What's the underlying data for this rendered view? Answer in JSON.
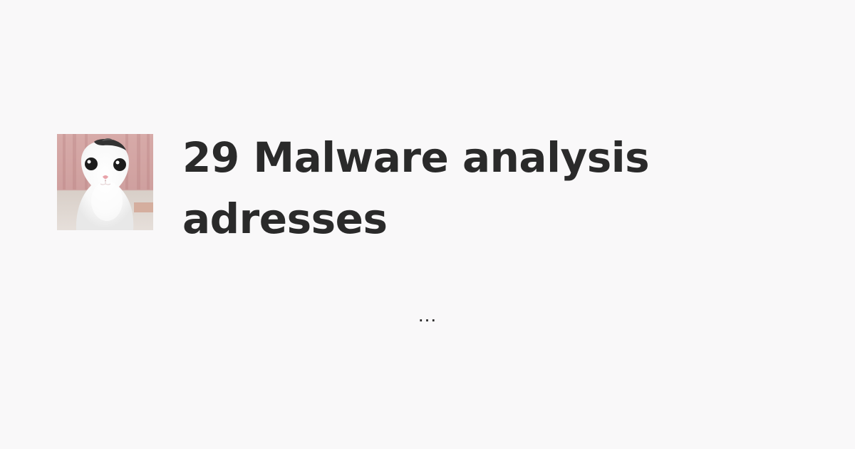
{
  "post": {
    "title": "29 Malware analysis adresses",
    "ellipsis": "...",
    "avatar": {
      "icon": "white-cat-photo-icon"
    }
  },
  "colors": {
    "background": "#f9f8f9",
    "text": "#2a2a2a"
  }
}
